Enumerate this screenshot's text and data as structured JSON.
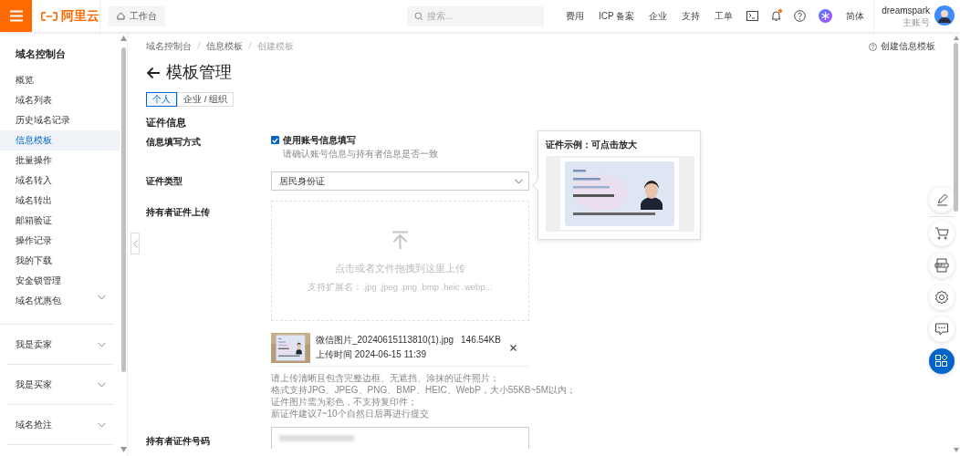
{
  "topbar": {
    "logo_text": "阿里云",
    "workbench": "工作台",
    "search": {
      "placeholder": "搜索..."
    },
    "nav": [
      "费用",
      "ICP 备案",
      "企业",
      "支持",
      "工单"
    ],
    "notification_dot": true,
    "language": "简体",
    "user": {
      "name": "dreamspark",
      "role": "主账号"
    }
  },
  "sidebar": {
    "title": "域名控制台",
    "items": [
      {
        "label": "概览",
        "kind": "link",
        "selected": false
      },
      {
        "label": "域名列表",
        "kind": "link",
        "selected": false
      },
      {
        "label": "历史域名记录",
        "kind": "link",
        "selected": false
      },
      {
        "label": "信息模板",
        "kind": "link",
        "selected": true
      },
      {
        "label": "批量操作",
        "kind": "link",
        "selected": false
      },
      {
        "label": "域名转入",
        "kind": "link",
        "selected": false
      },
      {
        "label": "域名转出",
        "kind": "link",
        "selected": false
      },
      {
        "label": "邮箱验证",
        "kind": "link",
        "selected": false
      },
      {
        "label": "操作记录",
        "kind": "link",
        "selected": false
      },
      {
        "label": "我的下载",
        "kind": "link",
        "selected": false
      },
      {
        "label": "安全锁管理",
        "kind": "link",
        "selected": false
      },
      {
        "label": "域名优惠包",
        "kind": "group",
        "selected": false,
        "expanded": false
      },
      {
        "label": "我是卖家",
        "kind": "group",
        "selected": false,
        "expanded": false
      },
      {
        "label": "我是买家",
        "kind": "group",
        "selected": false,
        "expanded": false
      },
      {
        "label": "域名抢注",
        "kind": "group",
        "selected": false,
        "expanded": false
      }
    ]
  },
  "breadcrumb": [
    "域名控制台",
    "信息模板",
    "创建模板"
  ],
  "help_link": "创建信息模板",
  "title": "模板管理",
  "tabs": [
    {
      "label": "个人",
      "selected": true
    },
    {
      "label": "企业 / 组织",
      "selected": false
    }
  ],
  "section": "证件信息",
  "form": {
    "fill_method": {
      "label": "信息填写方式",
      "checkbox": {
        "label": "使用账号信息填写",
        "checked": true
      },
      "hint": "请确认账号信息与持有者信息是否一致"
    },
    "id_type": {
      "label": "证件类型",
      "value": "居民身份证"
    },
    "upload": {
      "label": "持有者证件上传",
      "dropzone_text": "点击或者文件拖拽到这里上传",
      "dropzone_hint": "支持扩展名：.jpg .jpeg .png .bmp .heic .webp...",
      "file": {
        "name": "微信图片_20240615113810(1).jpg",
        "size": "146.54KB",
        "uploaded": "上传时间 2024-06-15 11:39"
      },
      "notes": [
        "请上传清晰且包含完整边框、无遮挡、涂抹的证件照片；",
        "格式支持JPG、JPEG、PNG、BMP、HEIC、WebP，大小55KB~5M以内；",
        "证件图片需为彩色，不支持复印件；",
        "新证件建议7~10个自然日后再进行提交"
      ]
    },
    "id_number": {
      "label": "持有者证件号码"
    }
  },
  "popover": {
    "title": "证件示例：可点击放大"
  }
}
